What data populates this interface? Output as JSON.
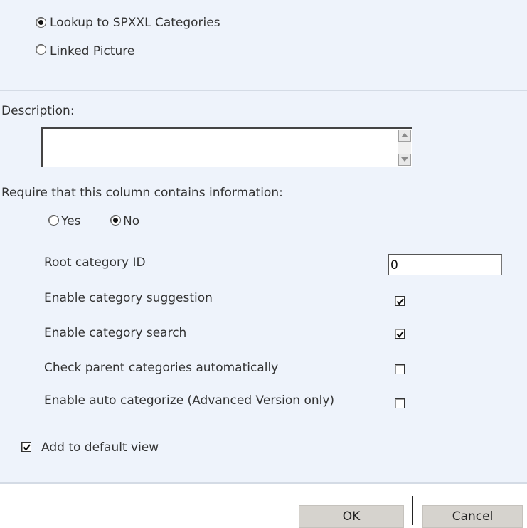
{
  "column_type": {
    "options": [
      {
        "label": "Lookup to SPXXL Categories",
        "selected": true
      },
      {
        "label": "Linked Picture",
        "selected": false
      }
    ]
  },
  "description": {
    "label": "Description:",
    "value": ""
  },
  "required": {
    "label": "Require that this column contains information:",
    "yes_label": "Yes",
    "no_label": "No",
    "selected": "No"
  },
  "settings": {
    "root_category_label": "Root category ID",
    "root_category_value": "0",
    "suggestion_label": "Enable category suggestion",
    "suggestion_checked": true,
    "search_label": "Enable category search",
    "search_checked": true,
    "check_parent_label": "Check parent categories automatically",
    "check_parent_checked": false,
    "auto_categorize_label": "Enable auto categorize (Advanced Version only)",
    "auto_categorize_checked": false
  },
  "default_view": {
    "label": "Add to default view",
    "checked": true
  },
  "buttons": {
    "ok_label": "OK",
    "cancel_label": "Cancel"
  }
}
